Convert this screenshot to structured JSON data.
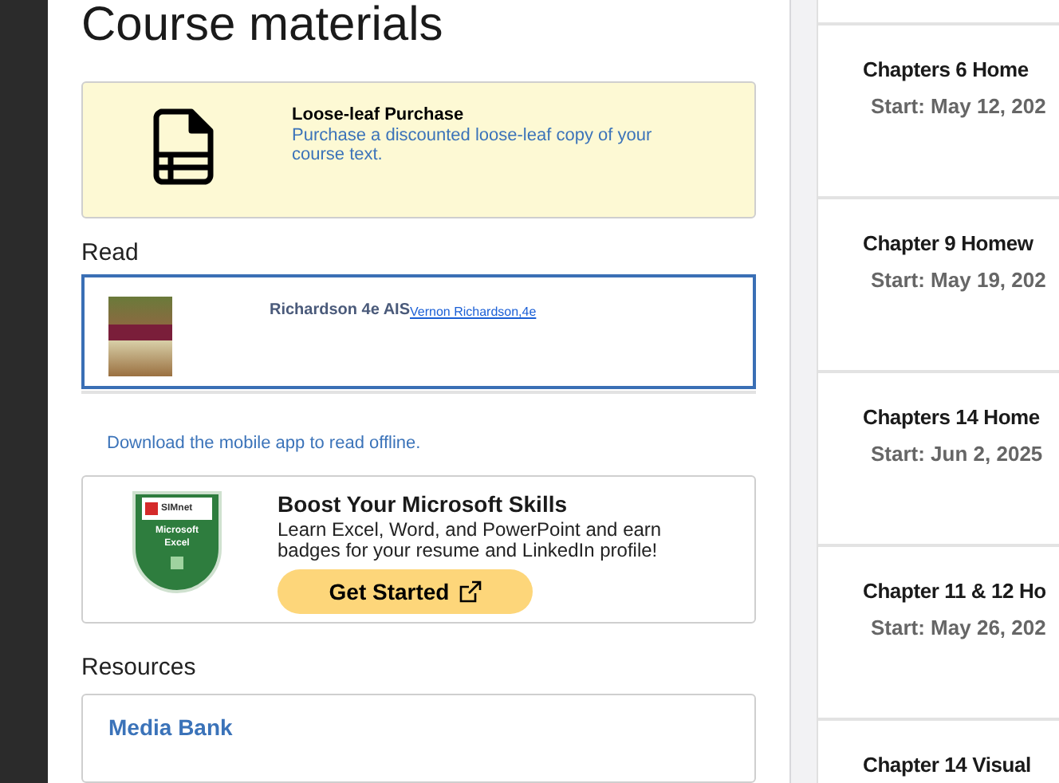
{
  "page_title": "Course materials",
  "purchase_card": {
    "title": "Loose-leaf Purchase",
    "description": "Purchase a discounted loose-leaf copy of your course text."
  },
  "read_section": {
    "heading": "Read",
    "book": {
      "title": "Richardson 4e AIS",
      "link": "Vernon Richardson,4e"
    },
    "note": "Download the mobile app to read offline."
  },
  "promo_card": {
    "badge_brand": "SIMnet",
    "badge_label": "Microsoft Excel",
    "title": "Boost Your Microsoft Skills",
    "description": "Learn Excel, Word, and PowerPoint and earn badges for your resume and LinkedIn profile!",
    "button": "Get Started"
  },
  "resources": {
    "heading": "Resources",
    "items": [
      "Media Bank"
    ]
  },
  "assignments": [
    {
      "title": "Chapters 6 Home",
      "start": "Start: May 12, 202"
    },
    {
      "title": "Chapter 9 Homew",
      "start": "Start: May 19, 202"
    },
    {
      "title": "Chapters 14 Home",
      "start": "Start: Jun 2, 2025"
    },
    {
      "title": "Chapter 11 & 12 Ho",
      "start": "Start: May 26, 202"
    },
    {
      "title": "Chapter 14 Visual"
    }
  ]
}
